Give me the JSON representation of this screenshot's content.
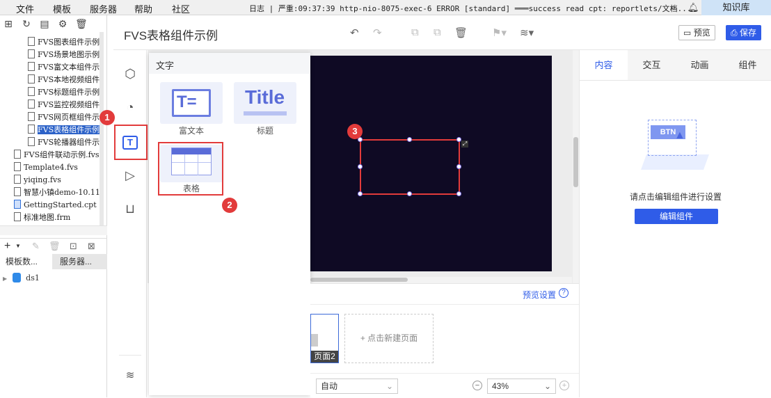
{
  "menubar": {
    "items": [
      "文件",
      "模板",
      "服务器",
      "帮助",
      "社区"
    ],
    "log": "日志 | 严重:09:37:39 http-nio-8075-exec-6 ERROR [standard] ═══success read cpt: reportlets/文档...",
    "knowledge": "知识库"
  },
  "tree": {
    "items": [
      {
        "label": "FVS图表组件示例"
      },
      {
        "label": "FVS场景地图示例"
      },
      {
        "label": "FVS富文本组件示"
      },
      {
        "label": "FVS本地视频组件"
      },
      {
        "label": "FVS标题组件示例"
      },
      {
        "label": "FVS监控视频组件"
      },
      {
        "label": "FVS网页框组件示"
      },
      {
        "label": "FVS表格组件示例"
      },
      {
        "label": "FVS轮播器组件示"
      }
    ],
    "root_items": [
      {
        "label": "FVS组件联动示例.fvs"
      },
      {
        "label": "Template4.fvs"
      },
      {
        "label": "yiqing.fvs"
      },
      {
        "label": "智慧小镇demo-10.11"
      },
      {
        "label": "GettingStarted.cpt"
      },
      {
        "label": "标准地图.frm"
      }
    ]
  },
  "left_tabs": {
    "tab1": "模板数...",
    "tab2": "服务器..."
  },
  "datasource": {
    "name": "ds1"
  },
  "header": {
    "title": "FVS表格组件示例",
    "preview": "预览",
    "save": "保存"
  },
  "popup": {
    "title": "文字",
    "cards": [
      {
        "label": "富文本",
        "glyph": "T="
      },
      {
        "label": "标题",
        "glyph": "Title"
      },
      {
        "label": "表格"
      }
    ]
  },
  "badges": [
    "1",
    "2",
    "3"
  ],
  "pagearea": {
    "preview_settings": "预览设置",
    "page2": "页面2",
    "new_page": "点击新建页面",
    "fit": "自动",
    "zoom": "43%"
  },
  "rpanel": {
    "tabs": [
      "内容",
      "交互",
      "动画",
      "组件"
    ],
    "illustration_text": "BTN",
    "hint": "请点击编辑组件进行设置",
    "edit_button": "编辑组件"
  },
  "colors": {
    "accent": "#2f5ce8",
    "canvas": "#0f0a24",
    "highlight": "#e23b3b"
  }
}
